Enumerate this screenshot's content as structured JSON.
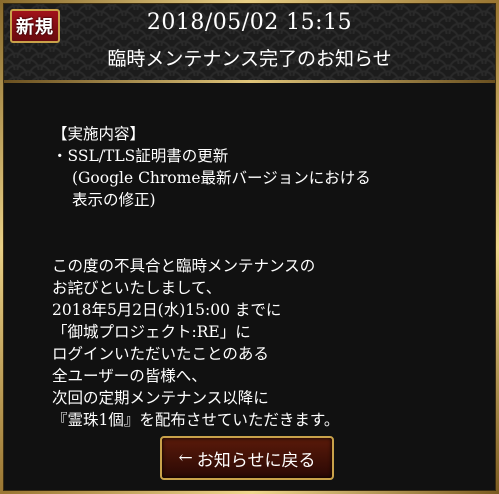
{
  "header": {
    "badge": "新規",
    "date": "2018/05/02  15:15",
    "title": "臨時メンテナンス完了のお知らせ"
  },
  "body": {
    "lines_top": [
      "【実施内容】",
      "・SSL/TLS証明書の更新"
    ],
    "lines_indent": [
      "(Google  Chrome最新バージョンにおける",
      "表示の修正)"
    ],
    "lines_bottom": [
      "この度の不具合と臨時メンテナンスの",
      "お詫びといたしまして、",
      "2018年5月2日(水)15:00  までに",
      "「御城プロジェクト:RE」に",
      "ログインいただいたことのある",
      "全ユーザーの皆様へ、",
      "次回の定期メンテナンス以降に",
      "『霊珠1個』を配布させていただきます。"
    ]
  },
  "back_button": {
    "arrow": "←",
    "label": "お知らせに戻る"
  }
}
